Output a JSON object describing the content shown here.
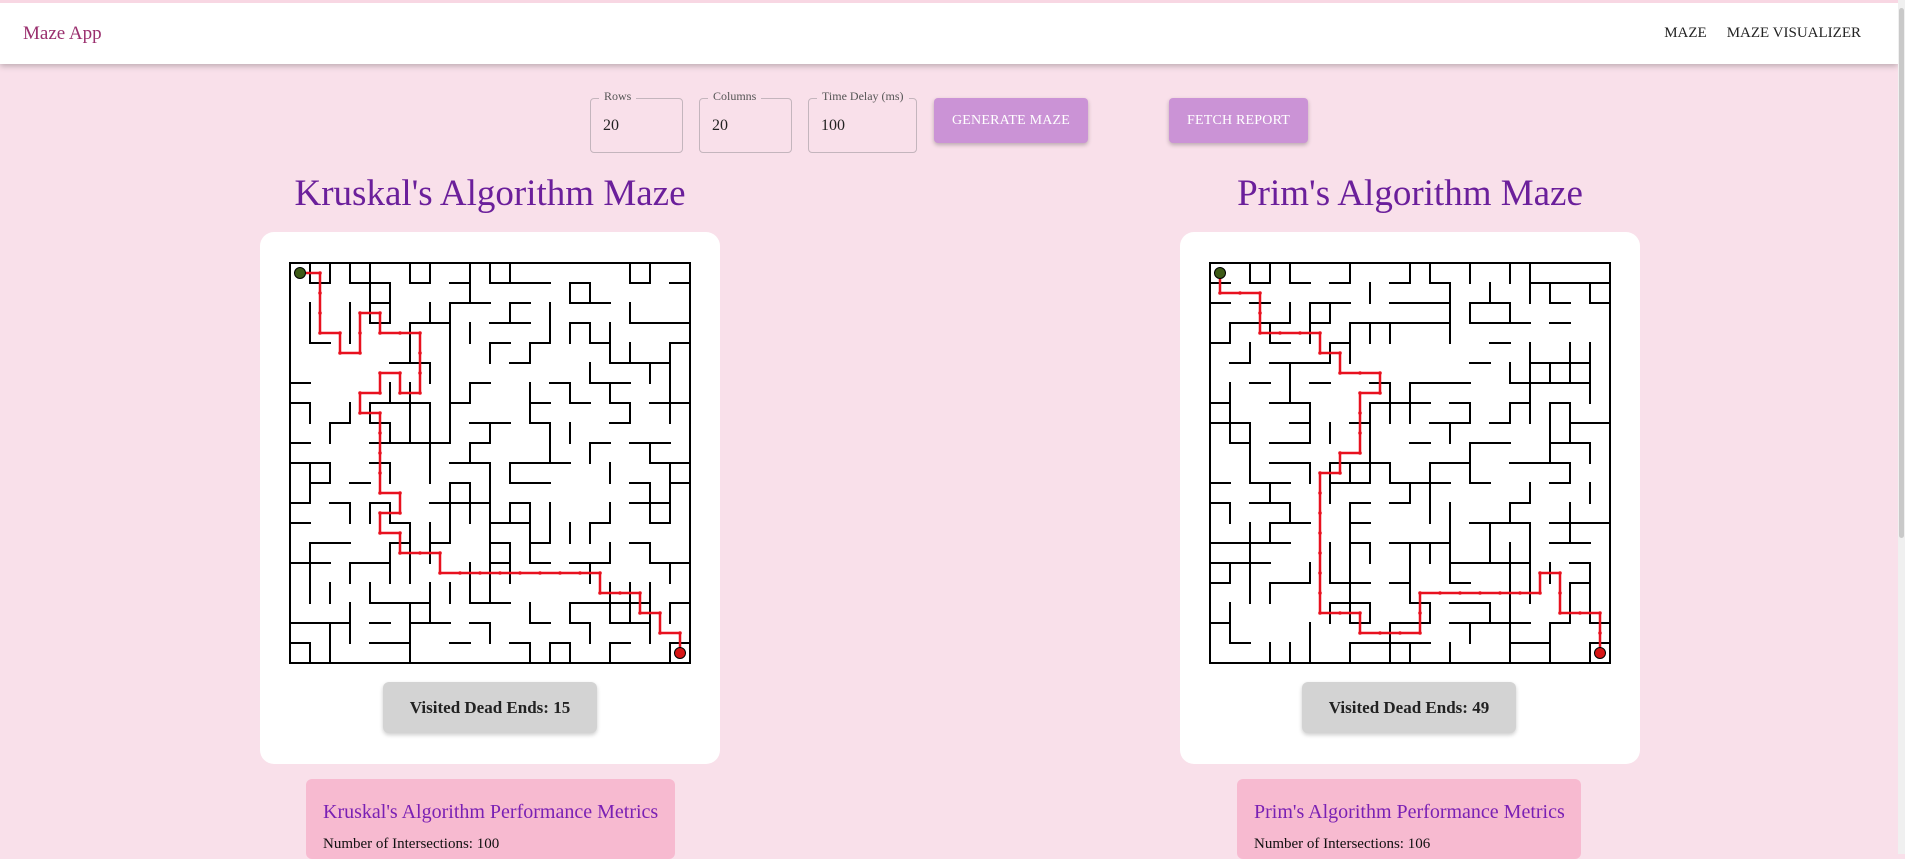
{
  "app": {
    "title": "Maze App"
  },
  "nav": {
    "items": [
      "MAZE",
      "MAZE VISUALIZER"
    ]
  },
  "controls": {
    "rows": {
      "label": "Rows",
      "value": "20"
    },
    "columns": {
      "label": "Columns",
      "value": "20"
    },
    "delay": {
      "label": "Time Delay (ms)",
      "value": "100"
    },
    "generate_label": "GENERATE MAZE",
    "report_label": "FETCH REPORT"
  },
  "kruskal": {
    "title": "Kruskal's Algorithm Maze",
    "dead_ends": "Visited Dead Ends: 15",
    "metrics_title": "Kruskal's Algorithm Performance Metrics",
    "intersections": "Number of Intersections: 100"
  },
  "prim": {
    "title": "Prim's Algorithm Maze",
    "dead_ends": "Visited Dead Ends: 49",
    "metrics_title": "Prim's Algorithm Performance Metrics",
    "intersections": "Number of Intersections: 106"
  },
  "colors": {
    "accent": "#cb93d6",
    "path": "#e8101e",
    "start": "#3d5a16",
    "end": "#d61414",
    "title": "#6b1f9b"
  }
}
